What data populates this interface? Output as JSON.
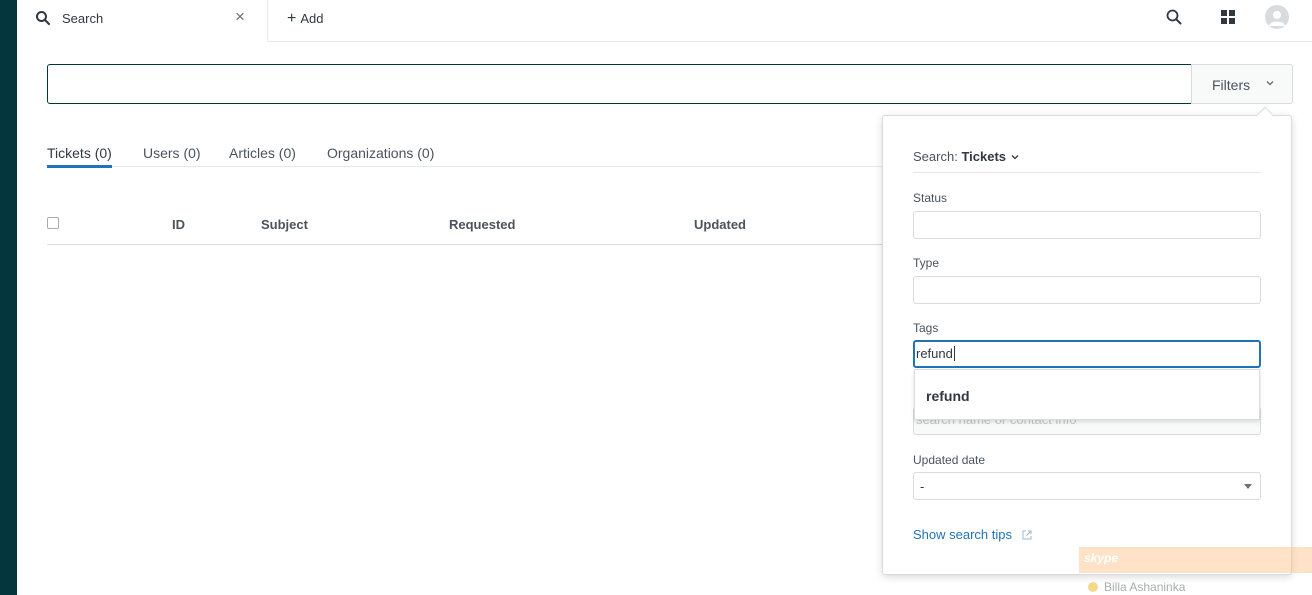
{
  "topbar": {
    "tab_label": "Search",
    "close_glyph": "×",
    "add_label": "Add",
    "icons": [
      "search-icon",
      "close-icon",
      "plus-icon",
      "apps-icon",
      "avatar-icon"
    ]
  },
  "search": {
    "value": "",
    "placeholder": "",
    "filters_label": "Filters"
  },
  "result_tabs": [
    {
      "label": "Tickets (0)",
      "active": true
    },
    {
      "label": "Users (0)",
      "active": false
    },
    {
      "label": "Articles (0)",
      "active": false
    },
    {
      "label": "Organizations (0)",
      "active": false
    }
  ],
  "table": {
    "columns": [
      "ID",
      "Subject",
      "Requested",
      "Updated"
    ],
    "rows": []
  },
  "filters_panel": {
    "scope_prefix": "Search:",
    "scope_value": "Tickets",
    "status_label": "Status",
    "status_value": "",
    "type_label": "Type",
    "type_value": "",
    "tags_label": "Tags",
    "tags_value": "refund",
    "suggestion": "refund",
    "assignee_placeholder": "search name or contact info",
    "updated_label": "Updated date",
    "updated_value": "-",
    "tips_label": "Show search tips"
  },
  "skype": {
    "logo": "skype",
    "user": "Billa Ashaninka"
  },
  "colors": {
    "sidebar": "#03363d",
    "accent": "#1f73b7",
    "search_border": "#03363d"
  }
}
